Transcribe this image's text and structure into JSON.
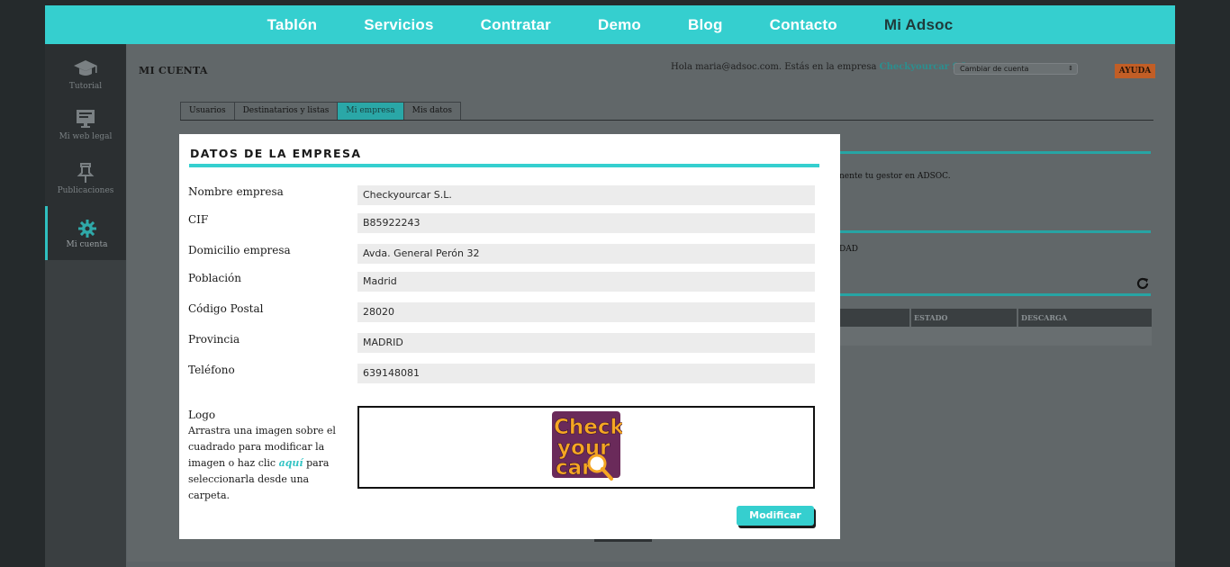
{
  "topnav": {
    "items": [
      "Tablón",
      "Servicios",
      "Contratar",
      "Demo",
      "Blog",
      "Contacto",
      "Mi Adsoc"
    ]
  },
  "sidebar": {
    "items": [
      {
        "label": "Tutorial",
        "icon": "graduation-cap-icon"
      },
      {
        "label": "Mi web legal",
        "icon": "monitor-icon"
      },
      {
        "label": "Publicaciones",
        "icon": "pin-icon"
      },
      {
        "label": "Mi cuenta",
        "icon": "gear-icon"
      }
    ]
  },
  "header": {
    "title": "MI CUENTA",
    "greeting_prefix": "Hola maria@adsoc.com. Estás en la empresa",
    "company": "Checkyourcar S.L.",
    "account_select": "Cambiar de cuenta",
    "help": "AYUDA"
  },
  "tabs": [
    "Usuarios",
    "Destinatarios y listas",
    "Mi empresa",
    "Mis datos"
  ],
  "background": {
    "text_gestor": "nente tu gestor en ADSOC.",
    "text_dad": "DAD",
    "table_headers": [
      "ESTADO",
      "DESCARGA"
    ]
  },
  "modal": {
    "title": "DATOS DE LA EMPRESA",
    "fields": [
      {
        "label": "Nombre empresa",
        "value": "Checkyourcar S.L."
      },
      {
        "label": "CIF",
        "value": "B85922243"
      },
      {
        "label": "Domicilio empresa",
        "value": "Avda. General Perón 32"
      },
      {
        "label": "Población",
        "value": "Madrid"
      },
      {
        "label": "Código Postal",
        "value": "28020"
      },
      {
        "label": "Provincia",
        "value": "MADRID"
      },
      {
        "label": "Teléfono",
        "value": "639148081"
      }
    ],
    "logo_label": "Logo",
    "logo_help_1": "Arrastra una imagen sobre el cuadrado para modificar la imagen o haz clic",
    "logo_help_link": "aquí",
    "logo_help_2": "para seleccionarla desde una carpeta.",
    "logo_text": [
      "Check",
      "your",
      "car"
    ],
    "submit": "Modificar"
  },
  "colors": {
    "accent": "#35cfcf",
    "help": "#c25e26",
    "logo_purple": "#6a2a5a",
    "logo_orange": "#f5a623"
  }
}
